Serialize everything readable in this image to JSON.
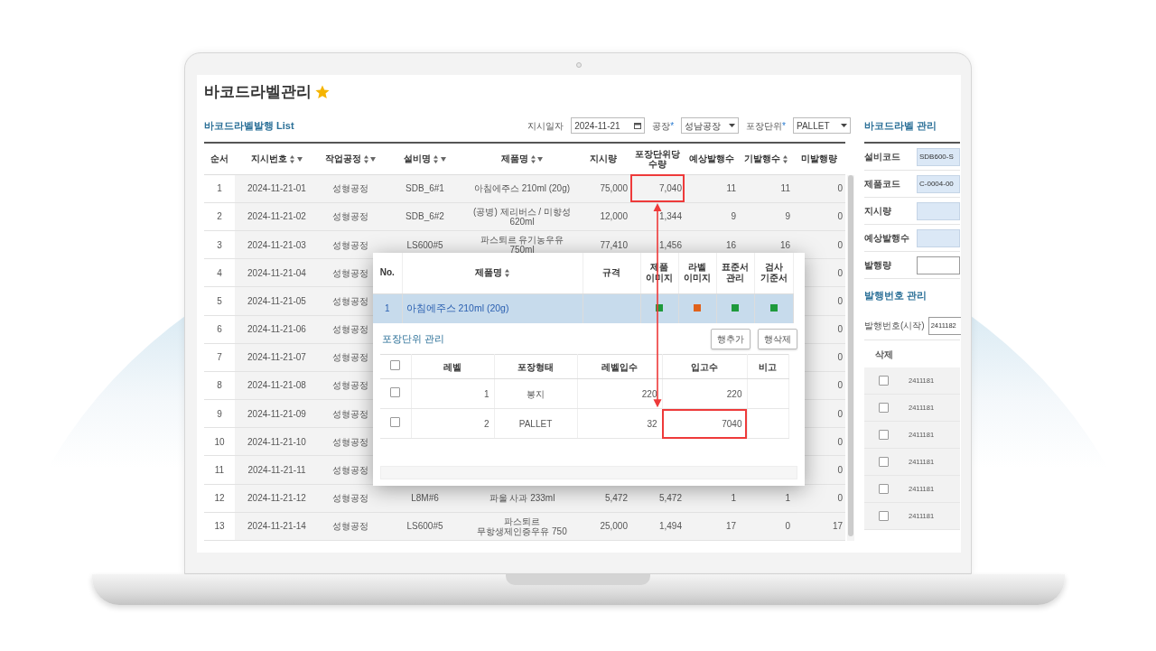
{
  "page": {
    "title": "바코드라벨관리",
    "favorite": true
  },
  "list": {
    "title": "바코드라벨발행 List",
    "filters": [
      {
        "kind": "date",
        "label": "지시일자",
        "value": "2024-11-21"
      },
      {
        "kind": "select",
        "label": "공장",
        "required_mark": "*",
        "value": "성남공장"
      },
      {
        "kind": "select",
        "label": "포장단위",
        "required_mark": "*",
        "value": "PALLET"
      }
    ],
    "columns": [
      {
        "label": "순서",
        "sortable": false,
        "filterable": false
      },
      {
        "label": "지시번호",
        "sortable": true,
        "filterable": true
      },
      {
        "label": "작업공정",
        "sortable": true,
        "filterable": true
      },
      {
        "label": "설비명",
        "sortable": true,
        "filterable": true
      },
      {
        "label": "제품명",
        "sortable": true,
        "filterable": true
      },
      {
        "label": "지시량",
        "sortable": false,
        "filterable": false
      },
      {
        "label": "포장단위당수량",
        "sortable": false,
        "filterable": false
      },
      {
        "label": "예상발행수",
        "sortable": false,
        "filterable": false
      },
      {
        "label": "기발행수",
        "sortable": true,
        "filterable": false
      },
      {
        "label": "미발행량",
        "sortable": false,
        "filterable": false
      }
    ],
    "rows": [
      {
        "highlighted": true,
        "cells": [
          "1",
          "2024-11-21-01",
          "성형공정",
          "SDB_6#1",
          "아침에주스 210ml (20g)",
          "75,000",
          "7,040",
          "11",
          "11",
          "0"
        ]
      },
      {
        "highlighted": false,
        "cells": [
          "2",
          "2024-11-21-02",
          "성형공정",
          "SDB_6#2",
          "(공병) 제리버스 / 미향성 620ml",
          "12,000",
          "1,344",
          "9",
          "9",
          "0"
        ]
      },
      {
        "highlighted": false,
        "cells": [
          "3",
          "2024-11-21-03",
          "성형공정",
          "LS600#5",
          "파스퇴르 유기농우유 750ml",
          "77,410",
          "1,456",
          "16",
          "16",
          "0"
        ]
      },
      {
        "highlighted": false,
        "cells": [
          "4",
          "2024-11-21-04",
          "성형공정",
          null,
          null,
          null,
          null,
          null,
          null,
          "0"
        ]
      },
      {
        "highlighted": false,
        "cells": [
          "5",
          "2024-11-21-05",
          "성형공정",
          null,
          null,
          null,
          null,
          null,
          null,
          "0"
        ]
      },
      {
        "highlighted": false,
        "cells": [
          "6",
          "2024-11-21-06",
          "성형공정",
          null,
          null,
          null,
          null,
          null,
          null,
          "0"
        ]
      },
      {
        "highlighted": false,
        "cells": [
          "7",
          "2024-11-21-07",
          "성형공정",
          null,
          null,
          null,
          null,
          null,
          null,
          "0"
        ]
      },
      {
        "highlighted": false,
        "cells": [
          "8",
          "2024-11-21-08",
          "성형공정",
          null,
          null,
          null,
          null,
          null,
          null,
          "0"
        ]
      },
      {
        "highlighted": false,
        "cells": [
          "9",
          "2024-11-21-09",
          "성형공정",
          null,
          null,
          null,
          null,
          null,
          null,
          "0"
        ]
      },
      {
        "highlighted": false,
        "cells": [
          "10",
          "2024-11-21-10",
          "성형공정",
          null,
          null,
          null,
          null,
          null,
          null,
          "0"
        ]
      },
      {
        "highlighted": false,
        "cells": [
          "11",
          "2024-11-21-11",
          "성형공정",
          null,
          null,
          null,
          null,
          null,
          null,
          "0"
        ]
      },
      {
        "highlighted": false,
        "cells": [
          "12",
          "2024-11-21-12",
          "성형공정",
          "L8M#6",
          "파울 사과 233ml",
          "5,472",
          "5,472",
          "1",
          "1",
          "0"
        ]
      },
      {
        "highlighted": false,
        "cells": [
          "13",
          "2024-11-21-14",
          "성형공정",
          "LS600#5",
          "파스퇴르 무항생제인증우유 750",
          "25,000",
          "1,494",
          "17",
          "0",
          "17"
        ]
      }
    ]
  },
  "popup": {
    "columns": [
      {
        "label": "No.",
        "sortable": false
      },
      {
        "label": "제품명",
        "sortable": true
      },
      {
        "label": "규격",
        "sortable": false
      },
      {
        "label": "제품 이미지",
        "sortable": false
      },
      {
        "label": "라벨 이미지",
        "sortable": false
      },
      {
        "label": "표준서 관리",
        "sortable": false
      },
      {
        "label": "검사 기준서",
        "sortable": false
      }
    ],
    "products": [
      {
        "no": "1",
        "name": "아침에주스 210ml (20g)",
        "selected": true,
        "statuses": [
          {
            "color": "#1e9a3c"
          },
          {
            "color": "#e0621c"
          },
          {
            "color": "#1e9a3c"
          },
          {
            "color": "#1e9a3c"
          }
        ]
      }
    ],
    "packaging": {
      "title": "포장단위 관리",
      "buttons": [
        "행추가",
        "행삭제"
      ],
      "header_checked": false,
      "columns": [
        "레벨",
        "포장형태",
        "레벨입수",
        "입고수",
        "비고"
      ],
      "rows": [
        {
          "checked": false,
          "level": "1",
          "form": "봉지",
          "per_level": "220",
          "received": "220",
          "highlighted": false
        },
        {
          "checked": false,
          "level": "2",
          "form": "PALLET",
          "per_level": "32",
          "received": "7040",
          "highlighted": true
        }
      ]
    }
  },
  "manage": {
    "title": "바코드라벨 관리",
    "fields": [
      {
        "label": "설비코드",
        "value": "SDB600-S",
        "readonly": true
      },
      {
        "label": "제품코드",
        "value": "C-0004-00",
        "readonly": true
      },
      {
        "label": "지시량",
        "readonly": true
      },
      {
        "label": "예상발행수",
        "readonly": true
      },
      {
        "label": "발행량",
        "readonly": false
      }
    ],
    "issue": {
      "title": "발행번호 관리",
      "start_label": "발행번호(시작)",
      "start_value": "2411182",
      "column": "삭제",
      "rows": [
        {
          "checked": false,
          "number": "2411181"
        },
        {
          "checked": false,
          "number": "2411181"
        },
        {
          "checked": false,
          "number": "2411181"
        },
        {
          "checked": false,
          "number": "2411181"
        },
        {
          "checked": false,
          "number": "2411181"
        },
        {
          "checked": false,
          "number": "2411181"
        }
      ]
    }
  }
}
